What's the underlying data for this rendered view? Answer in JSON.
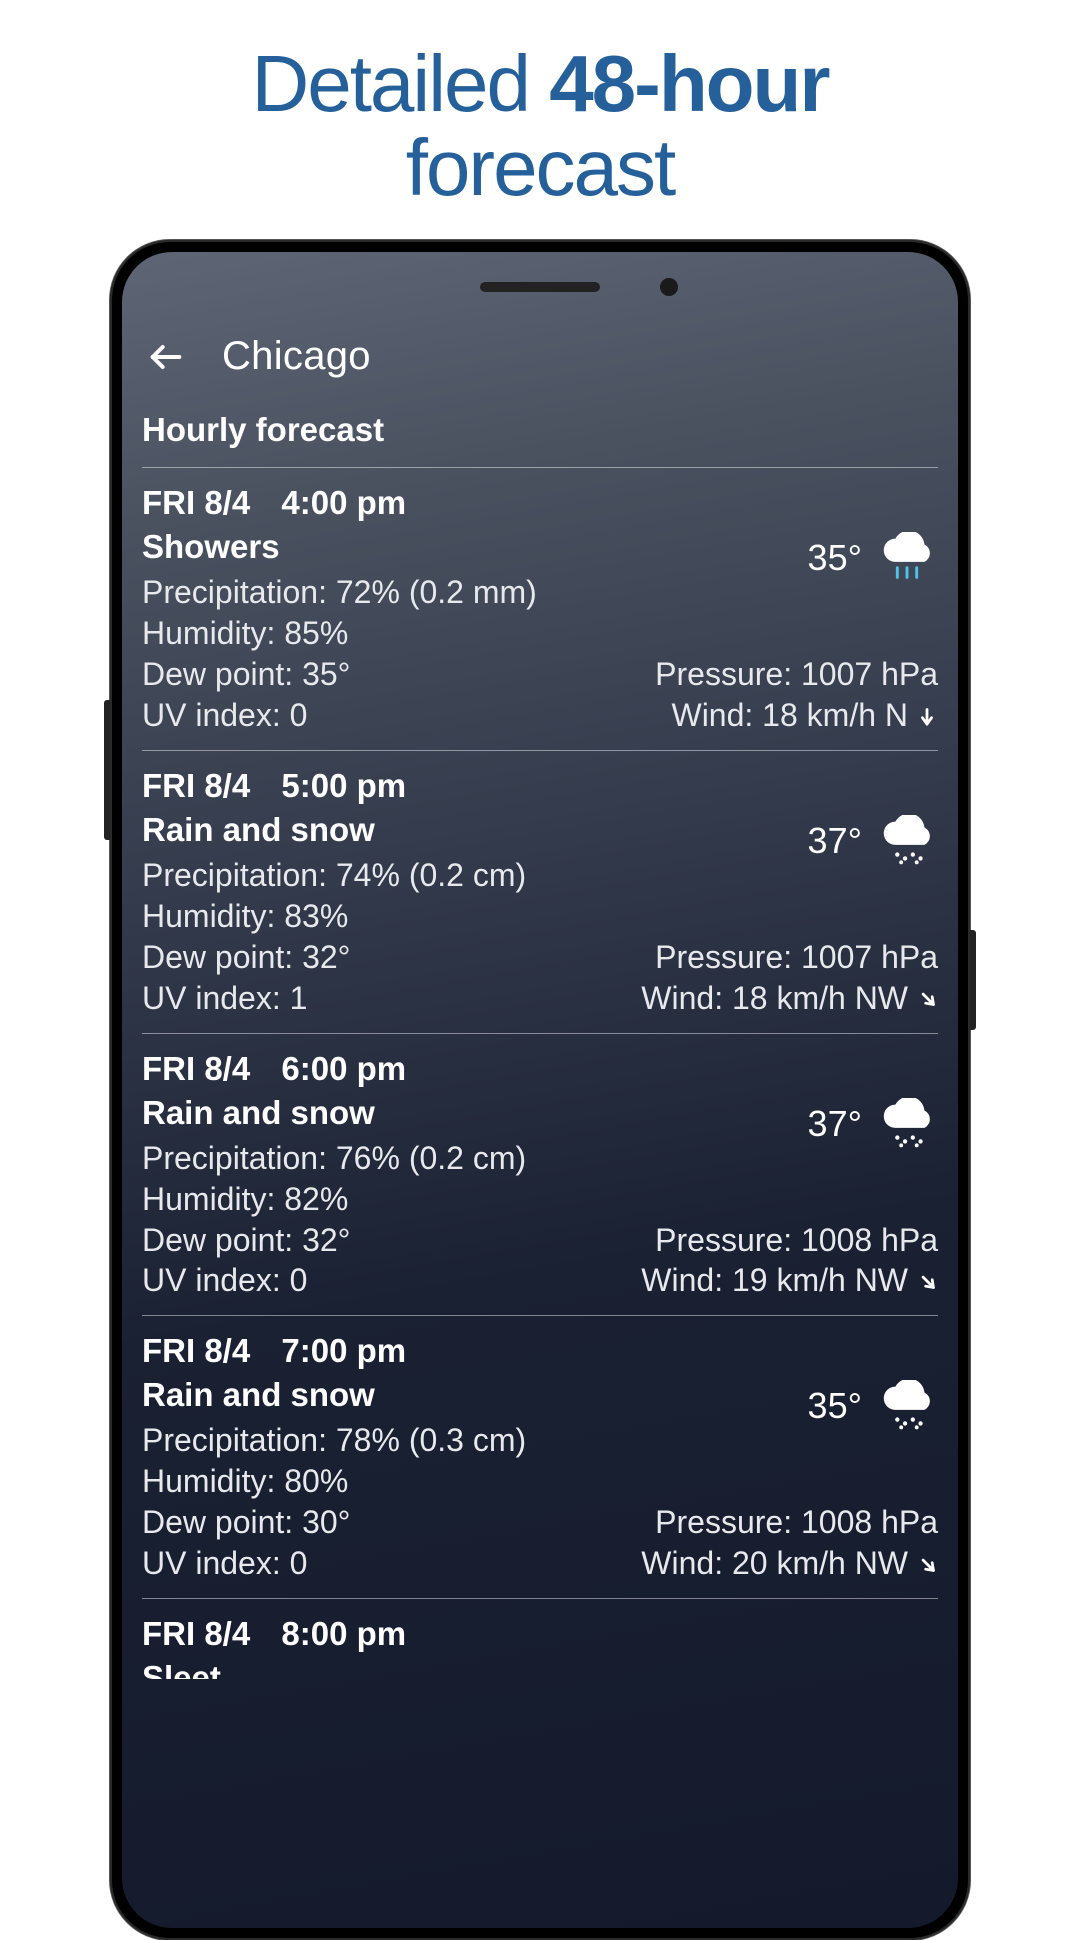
{
  "marketing": {
    "line1_a": "Detailed ",
    "line1_b": "48-hour",
    "line2": "forecast"
  },
  "app": {
    "city": "Chicago",
    "section_title": "Hourly forecast",
    "labels": {
      "precipitation": "Precipitation",
      "humidity": "Humidity",
      "dew_point": "Dew point",
      "uv_index": "UV index",
      "pressure": "Pressure",
      "wind": "Wind"
    },
    "hours": [
      {
        "date": "FRI 8/4",
        "time": "4:00 pm",
        "condition": "Showers",
        "icon": "showers",
        "temp": "35°",
        "precipitation": "72% (0.2 mm)",
        "humidity": "85%",
        "dew_point": "35°",
        "uv_index": "0",
        "pressure": "1007 hPa",
        "wind": "18 km/h N",
        "wind_dir_deg": 180
      },
      {
        "date": "FRI 8/4",
        "time": "5:00 pm",
        "condition": "Rain and snow",
        "icon": "rain-snow",
        "temp": "37°",
        "precipitation": "74% (0.2 cm)",
        "humidity": "83%",
        "dew_point": "32°",
        "uv_index": "1",
        "pressure": "1007 hPa",
        "wind": "18 km/h NW",
        "wind_dir_deg": 135
      },
      {
        "date": "FRI 8/4",
        "time": "6:00 pm",
        "condition": "Rain and snow",
        "icon": "rain-snow",
        "temp": "37°",
        "precipitation": "76% (0.2 cm)",
        "humidity": "82%",
        "dew_point": "32°",
        "uv_index": "0",
        "pressure": "1008 hPa",
        "wind": "19 km/h NW",
        "wind_dir_deg": 135
      },
      {
        "date": "FRI 8/4",
        "time": "7:00 pm",
        "condition": "Rain and snow",
        "icon": "rain-snow",
        "temp": "35°",
        "precipitation": "78% (0.3 cm)",
        "humidity": "80%",
        "dew_point": "30°",
        "uv_index": "0",
        "pressure": "1008 hPa",
        "wind": "20 km/h NW",
        "wind_dir_deg": 135
      },
      {
        "date": "FRI 8/4",
        "time": "8:00 pm",
        "condition": "Sleet",
        "icon": "rain-snow",
        "temp": "",
        "precipitation": "",
        "humidity": "",
        "dew_point": "",
        "uv_index": "",
        "pressure": "",
        "wind": "",
        "wind_dir_deg": 135,
        "truncated": true
      }
    ]
  }
}
